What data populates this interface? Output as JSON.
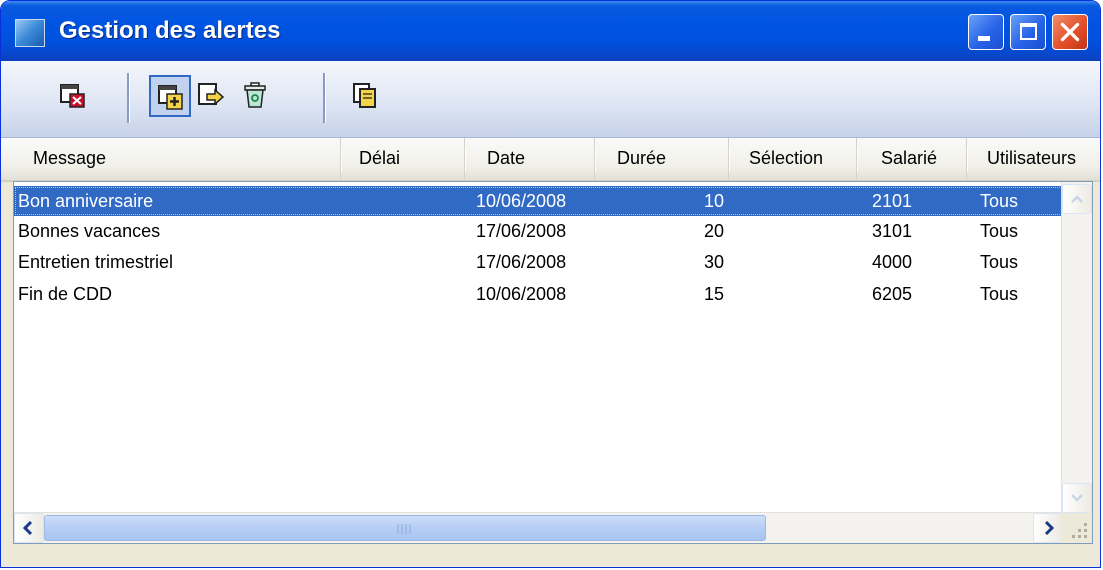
{
  "window": {
    "title": "Gestion des alertes",
    "icons": {
      "app": "window-app-icon",
      "minimize": "minimize-icon",
      "maximize": "maximize-icon",
      "close": "close-icon"
    }
  },
  "toolbar": {
    "buttons": [
      {
        "name": "close-alerts-button",
        "icon": "window-close-icon",
        "pressed": false
      },
      {
        "name": "add-alert-button",
        "icon": "window-add-icon",
        "pressed": true
      },
      {
        "name": "edit-alert-button",
        "icon": "edit-arrow-icon",
        "pressed": false
      },
      {
        "name": "delete-alert-button",
        "icon": "recycle-bin-icon",
        "pressed": false
      },
      {
        "name": "copy-alert-button",
        "icon": "document-copy-icon",
        "pressed": false
      }
    ]
  },
  "table": {
    "columns": [
      "Message",
      "Délai",
      "Date",
      "Durée",
      "Sélection",
      "Salarié",
      "Utilisateurs"
    ],
    "rows": [
      {
        "message": "Bon anniversaire",
        "delai": "",
        "date": "10/06/2008",
        "duree": "10",
        "selection": "",
        "salarie": "2101",
        "utilisateurs": "Tous",
        "selected": true
      },
      {
        "message": "Bonnes vacances",
        "delai": "",
        "date": "17/06/2008",
        "duree": "20",
        "selection": "",
        "salarie": "3101",
        "utilisateurs": "Tous",
        "selected": false
      },
      {
        "message": "Entretien trimestriel",
        "delai": "",
        "date": "17/06/2008",
        "duree": "30",
        "selection": "",
        "salarie": "4000",
        "utilisateurs": "Tous",
        "selected": false
      },
      {
        "message": "Fin de CDD",
        "delai": "",
        "date": "10/06/2008",
        "duree": "15",
        "selection": "",
        "salarie": "6205",
        "utilisateurs": "Tous",
        "selected": false
      }
    ]
  },
  "colors": {
    "selection": "#316ac5",
    "titlebar": "#0054e3",
    "close_button": "#e4502a"
  }
}
